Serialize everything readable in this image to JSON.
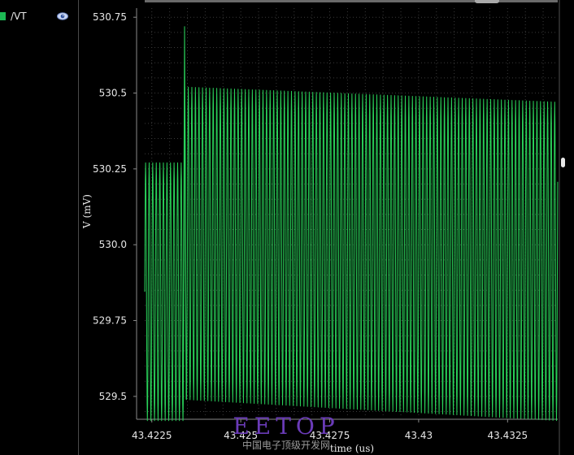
{
  "legend": {
    "label": "/VT",
    "color": "#1db954"
  },
  "icons": {
    "visibility": "eye-icon"
  },
  "watermark": {
    "logo": "EETOP",
    "subtitle": "中国电子顶级开发网"
  },
  "colors": {
    "background": "#000000",
    "trace": "#2ad35a",
    "grid": "#3a3a3a",
    "axis_text": "#e6e6e6"
  },
  "chart_data": {
    "type": "line",
    "title": "",
    "xlabel": "time (us)",
    "ylabel": "V (mV)",
    "xlim": [
      43.4223,
      43.43391
    ],
    "ylim": [
      529.43,
      530.78
    ],
    "x_ticks": [
      43.4225,
      43.425,
      43.4275,
      43.43,
      43.4325
    ],
    "x_tick_labels": [
      "43.4225",
      "43.425",
      "43.4275",
      "43.43",
      "43.4325"
    ],
    "y_ticks": [
      529.5,
      529.75,
      530.0,
      530.25,
      530.5,
      530.75
    ],
    "y_tick_labels": [
      "529.5",
      "529.75",
      "530.0",
      "530.25",
      "530.5",
      "530.75"
    ],
    "grid": true,
    "series": [
      {
        "name": "/VT",
        "waveform": "sinusoidal-oscillation",
        "period_us": 0.0001,
        "segments": [
          {
            "x_start": 43.4223,
            "x_end": 43.42342,
            "y_max": 530.27,
            "y_min": 529.42
          },
          {
            "x_start": 43.42342,
            "x_end": 43.43391,
            "y_max_start": 530.52,
            "y_max_end": 530.47,
            "y_min_start": 529.49,
            "y_min_end": 529.42
          }
        ],
        "spike": {
          "x": 43.42342,
          "y": 530.72
        }
      }
    ]
  }
}
